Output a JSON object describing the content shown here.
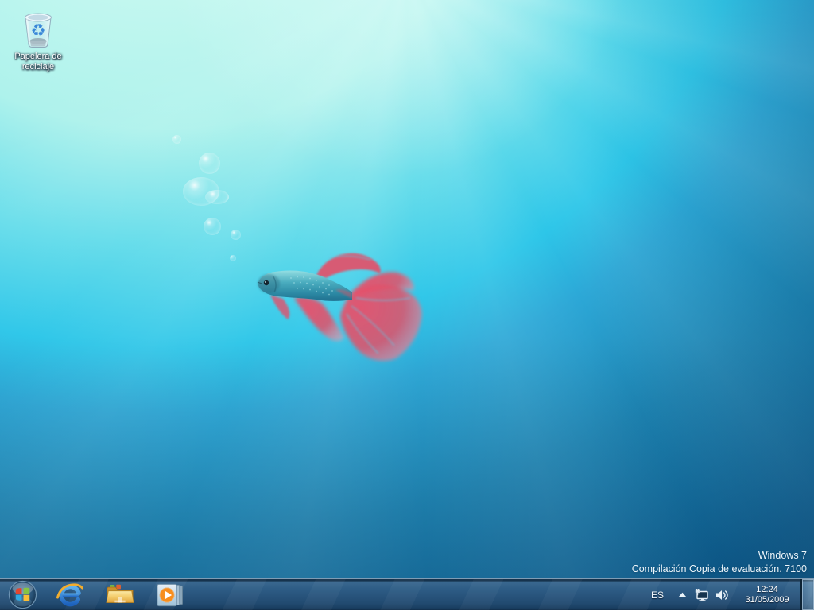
{
  "wallpaper": {
    "theme": "windows7-beta-betta-fish-underwater",
    "colors": {
      "light": "#aef2ec",
      "mid": "#29c5e8",
      "deep": "#0b6296",
      "taskbar": "#27527a"
    }
  },
  "desktop": {
    "recycle_bin": {
      "label_line1": "Papelera de",
      "label_line2": "reciclaje",
      "symbol": "♻",
      "icon": "recycle-bin-icon"
    },
    "watermark": {
      "line1": "Windows 7",
      "line2": "Compilación Copia de evaluación. 7100"
    }
  },
  "taskbar": {
    "start": {
      "icon": "windows-start-orb"
    },
    "pinned": [
      {
        "name": "internet-explorer",
        "icon": "internet-explorer-icon"
      },
      {
        "name": "windows-explorer",
        "icon": "folder-icon"
      },
      {
        "name": "windows-media-player",
        "icon": "media-player-icon"
      }
    ],
    "tray": {
      "language": "ES",
      "hidden_icons_icon": "chevron-up-icon",
      "network_icon": "network-icon",
      "volume_icon": "speaker-icon",
      "clock": {
        "time": "12:24",
        "date": "31/05/2009"
      },
      "show_desktop_icon": "show-desktop-button"
    }
  }
}
